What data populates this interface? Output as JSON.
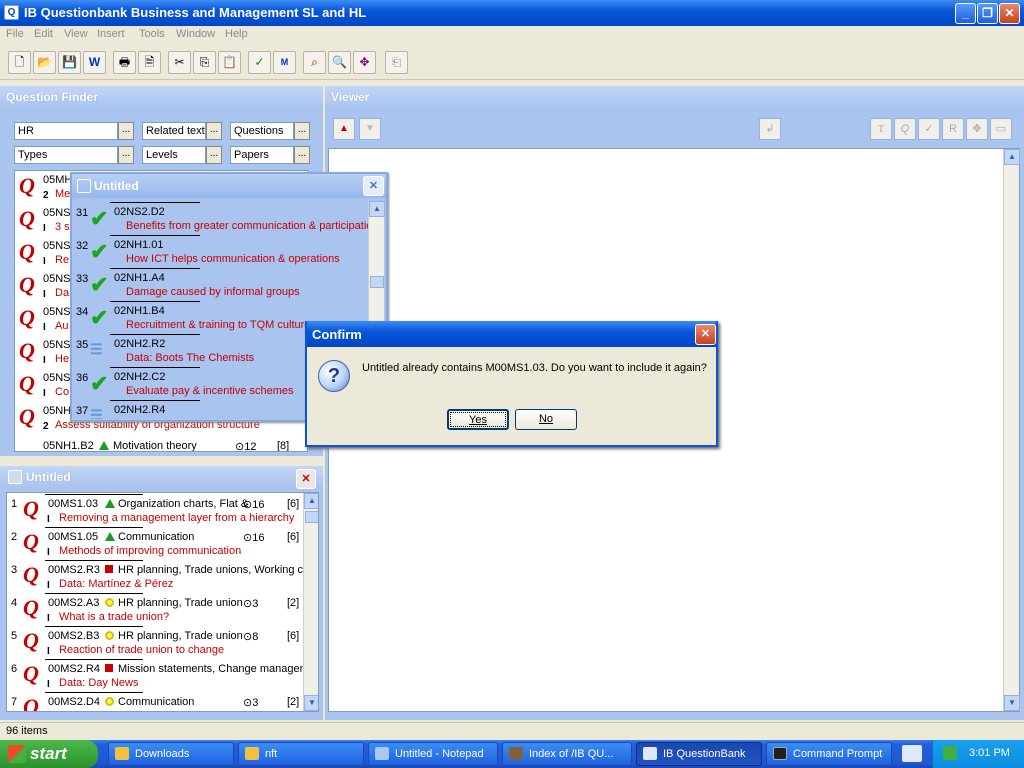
{
  "window": {
    "title": "IB Questionbank Business and Management SL and HL",
    "min": "_",
    "max": "❐",
    "close": "✕"
  },
  "menu": [
    "File",
    "Edit",
    "View",
    "Insert",
    "Tools",
    "Window",
    "Help"
  ],
  "question_finder": {
    "title": "Question Finder",
    "fields": [
      {
        "value": "HR"
      },
      {
        "value": "Related text"
      },
      {
        "value": "Questions"
      },
      {
        "value": "Types"
      },
      {
        "value": "Levels"
      },
      {
        "value": "Papers"
      }
    ],
    "ellipsis": "...",
    "rows": [
      {
        "code": "05MH",
        "sub": "Me",
        "mark": "2"
      },
      {
        "code": "05NS",
        "sub": "3 s",
        "mark": "I"
      },
      {
        "code": "05NS",
        "sub": "Re",
        "mark": "I"
      },
      {
        "code": "05NS",
        "sub": "Da",
        "mark": "I"
      },
      {
        "code": "05NS",
        "sub": "Au",
        "mark": "I"
      },
      {
        "code": "05NS",
        "sub": "He",
        "mark": "I"
      },
      {
        "code": "05NS",
        "sub": "Co",
        "mark": "I"
      },
      {
        "code": "05NH",
        "sub": "Assess suitability of organization structure",
        "mark": "2"
      }
    ],
    "partial_row": {
      "code": "05NH1.B2",
      "topic": "Motivation theory",
      "time": "⊙12",
      "marks": "[8]"
    }
  },
  "untitled_float": {
    "title": "Untitled",
    "rows": [
      {
        "n": "31",
        "code": "02NS2.D2",
        "sub": "Benefits from greater communication & participation",
        "status": "check"
      },
      {
        "n": "32",
        "code": "02NH1.01",
        "sub": "How ICT helps communication & operations",
        "status": "check"
      },
      {
        "n": "33",
        "code": "02NH1.A4",
        "sub": "Damage caused by informal groups",
        "status": "check"
      },
      {
        "n": "34",
        "code": "02NH1.B4",
        "sub": "Recruitment & training to TQM culture",
        "status": "check"
      },
      {
        "n": "35",
        "code": "02NH2.R2",
        "sub": "Data: Boots The Chemists",
        "status": "lines"
      },
      {
        "n": "36",
        "code": "02NH2.C2",
        "sub": "Evaluate pay & incentive schemes",
        "status": "check"
      },
      {
        "n": "37",
        "code": "02NH2.R4",
        "sub": "",
        "status": "lines"
      }
    ]
  },
  "untitled_list": {
    "title": "Untitled",
    "rows": [
      {
        "n": "1",
        "code": "00MS1.03",
        "shape": "tri",
        "topic": "Organization charts, Flat &",
        "time": "⊙16",
        "marks": "[6]",
        "sub": "Removing a management layer from a hierarchy"
      },
      {
        "n": "2",
        "code": "00MS1.05",
        "shape": "tri",
        "topic": "Communication",
        "time": "⊙16",
        "marks": "[6]",
        "sub": "Methods of improving communication"
      },
      {
        "n": "3",
        "code": "00MS2.R3",
        "shape": "sq",
        "topic": "HR planning, Trade unions, Working c",
        "time": "",
        "marks": "",
        "sub": "Data: Martínez & Pérez"
      },
      {
        "n": "4",
        "code": "00MS2.A3",
        "shape": "dot",
        "topic": "HR planning, Trade union",
        "time": "⊙3",
        "marks": "[2]",
        "sub": "What is a trade union?"
      },
      {
        "n": "5",
        "code": "00MS2.B3",
        "shape": "dot",
        "topic": "HR planning, Trade union",
        "time": "⊙8",
        "marks": "[6]",
        "sub": "Reaction of trade union to change"
      },
      {
        "n": "6",
        "code": "00MS2.R4",
        "shape": "sq",
        "topic": "Mission statements, Change manageme",
        "time": "",
        "marks": "",
        "sub": "Data: Day News"
      },
      {
        "n": "7",
        "code": "00MS2.D4",
        "shape": "dot",
        "topic": "Communication",
        "time": "⊙3",
        "marks": "[2]",
        "sub": ""
      }
    ]
  },
  "viewer": {
    "title": "Viewer"
  },
  "confirm": {
    "title": "Confirm",
    "message": "Untitled already contains M00MS1.03. Do you want to include it again?",
    "yes": "Yes",
    "no": "No"
  },
  "status": {
    "text": "96 items"
  },
  "taskbar": {
    "start": "start",
    "tasks": [
      {
        "label": "Downloads",
        "color": "#f0c040"
      },
      {
        "label": "nft",
        "color": "#f0c040"
      },
      {
        "label": "Untitled - Notepad",
        "color": "#a8c8f0"
      },
      {
        "label": "Index of /IB QU...",
        "color": "#806040"
      },
      {
        "label": "IB QuestionBank",
        "color": "#dde8f8"
      },
      {
        "label": "Command Prompt",
        "color": "#202020"
      }
    ],
    "clock": "3:01 PM"
  }
}
